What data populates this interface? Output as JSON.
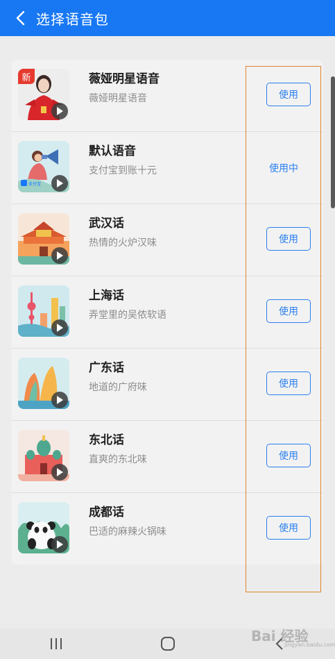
{
  "header": {
    "title": "选择语音包",
    "bg_color": "#1878f3"
  },
  "voices": [
    {
      "name": "薇娅明星语音",
      "desc": "薇娅明星语音",
      "action": "使用",
      "status": "",
      "tag": "新"
    },
    {
      "name": "默认语音",
      "desc": "支付宝到账十元",
      "action": "",
      "status": "使用中",
      "tag": ""
    },
    {
      "name": "武汉话",
      "desc": "热情的火炉汉味",
      "action": "使用",
      "status": "",
      "tag": ""
    },
    {
      "name": "上海话",
      "desc": "弄堂里的吴侬软语",
      "action": "使用",
      "status": "",
      "tag": ""
    },
    {
      "name": "广东话",
      "desc": "地道的广府味",
      "action": "使用",
      "status": "",
      "tag": ""
    },
    {
      "name": "东北话",
      "desc": "直爽的东北味",
      "action": "使用",
      "status": "",
      "tag": ""
    },
    {
      "name": "成都话",
      "desc": "巴适的麻辣火锅味",
      "action": "使用",
      "status": "",
      "tag": ""
    }
  ],
  "thumb_badge_text": "支付宝",
  "watermark": {
    "text": "Bai 经验",
    "sub": "jingyan.baidu.com"
  },
  "colors": {
    "accent": "#2a7ff0",
    "highlight_box": "#e0832a",
    "new_tag": "#e53a2f"
  },
  "icons": {
    "back": "chevron-left-icon",
    "play": "play-icon",
    "nav_recent": "recent-apps-icon",
    "nav_home": "home-icon",
    "nav_back": "back-icon"
  }
}
